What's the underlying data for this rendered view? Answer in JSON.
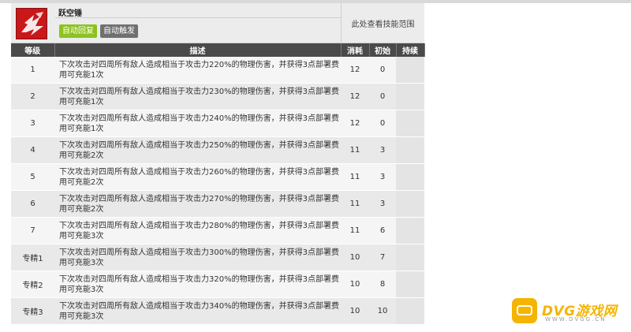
{
  "skill": {
    "name": "跃空锤",
    "tags": [
      "自动回复",
      "自动触发"
    ],
    "range_link": "此处查看技能范围",
    "icon": "red-hammer-skill-icon"
  },
  "table": {
    "headers": [
      "等级",
      "描述",
      "消耗",
      "初始",
      "持续"
    ],
    "rows": [
      {
        "level": "1",
        "desc": "下次攻击对四周所有敌人造成相当于攻击力220%的物理伤害，并获得3点部署费用可充能1次",
        "cost": "12",
        "initial": "0",
        "duration": ""
      },
      {
        "level": "2",
        "desc": "下次攻击对四周所有敌人造成相当于攻击力230%的物理伤害，并获得3点部署费用可充能1次",
        "cost": "12",
        "initial": "0",
        "duration": ""
      },
      {
        "level": "3",
        "desc": "下次攻击对四周所有敌人造成相当于攻击力240%的物理伤害，并获得3点部署费用可充能1次",
        "cost": "12",
        "initial": "0",
        "duration": ""
      },
      {
        "level": "4",
        "desc": "下次攻击对四周所有敌人造成相当于攻击力250%的物理伤害，并获得3点部署费用可充能2次",
        "cost": "11",
        "initial": "3",
        "duration": ""
      },
      {
        "level": "5",
        "desc": "下次攻击对四周所有敌人造成相当于攻击力260%的物理伤害，并获得3点部署费用可充能2次",
        "cost": "11",
        "initial": "3",
        "duration": ""
      },
      {
        "level": "6",
        "desc": "下次攻击对四周所有敌人造成相当于攻击力270%的物理伤害，并获得3点部署费用可充能2次",
        "cost": "11",
        "initial": "3",
        "duration": ""
      },
      {
        "level": "7",
        "desc": "下次攻击对四周所有敌人造成相当于攻击力280%的物理伤害，并获得3点部署费用可充能3次",
        "cost": "11",
        "initial": "6",
        "duration": ""
      },
      {
        "level": "专精1",
        "desc": "下次攻击对四周所有敌人造成相当于攻击力300%的物理伤害，并获得3点部署费用可充能3次",
        "cost": "10",
        "initial": "7",
        "duration": ""
      },
      {
        "level": "专精2",
        "desc": "下次攻击对四周所有敌人造成相当于攻击力320%的物理伤害，并获得3点部署费用可充能3次",
        "cost": "10",
        "initial": "8",
        "duration": ""
      },
      {
        "level": "专精3",
        "desc": "下次攻击对四周所有敌人造成相当于攻击力340%的物理伤害，并获得3点部署费用可充能3次",
        "cost": "10",
        "initial": "10",
        "duration": ""
      }
    ]
  },
  "watermark": {
    "title": "DVG游戏网",
    "url": "WWW.DVGG.CN",
    "color": "#f5b400"
  }
}
